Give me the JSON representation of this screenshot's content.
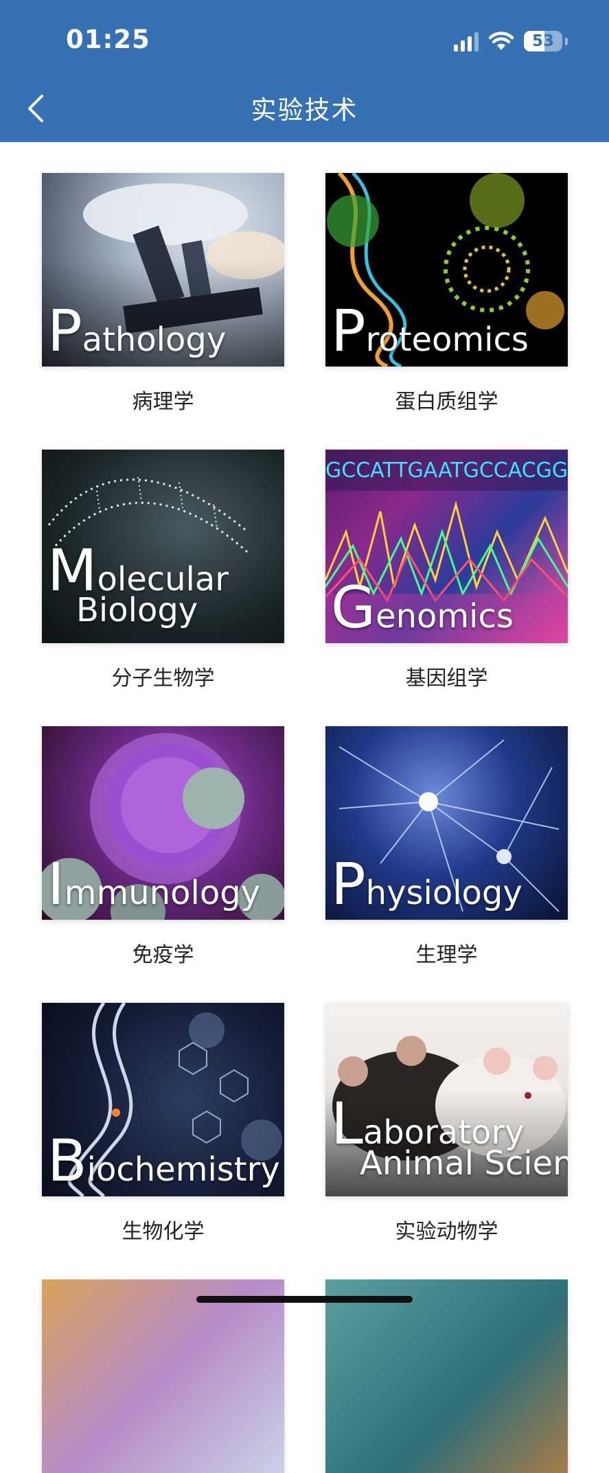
{
  "status_bar": {
    "time": "01:25",
    "battery": "53",
    "battery_level_percent": 53
  },
  "header": {
    "back_icon": "chevron-left-icon",
    "title": "实验技术"
  },
  "cards": [
    {
      "id": "pathology",
      "cover_initial": "P",
      "cover_rest": "athology",
      "cover_line2": "",
      "caption": "病理学"
    },
    {
      "id": "proteomics",
      "cover_initial": "P",
      "cover_rest": "roteomics",
      "cover_line2": "",
      "caption": "蛋白质组学"
    },
    {
      "id": "molecular-biology",
      "cover_initial": "M",
      "cover_rest": "olecular",
      "cover_line2": "Biology",
      "caption": "分子生物学"
    },
    {
      "id": "genomics",
      "cover_initial": "G",
      "cover_rest": "enomics",
      "cover_line2": "",
      "caption": "基因组学"
    },
    {
      "id": "immunology",
      "cover_initial": "I",
      "cover_rest": "mmunology",
      "cover_line2": "",
      "caption": "免疫学"
    },
    {
      "id": "physiology",
      "cover_initial": "P",
      "cover_rest": "hysiology",
      "cover_line2": "",
      "caption": "生理学"
    },
    {
      "id": "biochemistry",
      "cover_initial": "B",
      "cover_rest": "iochemistry",
      "cover_line2": "",
      "caption": "生物化学"
    },
    {
      "id": "laboratory-animal-science",
      "cover_initial": "L",
      "cover_rest": "aboratory",
      "cover_line2": "Animal Science",
      "caption": "实验动物学"
    }
  ],
  "colors": {
    "header_bg": "#3671b4",
    "caption_text": "#222222"
  }
}
